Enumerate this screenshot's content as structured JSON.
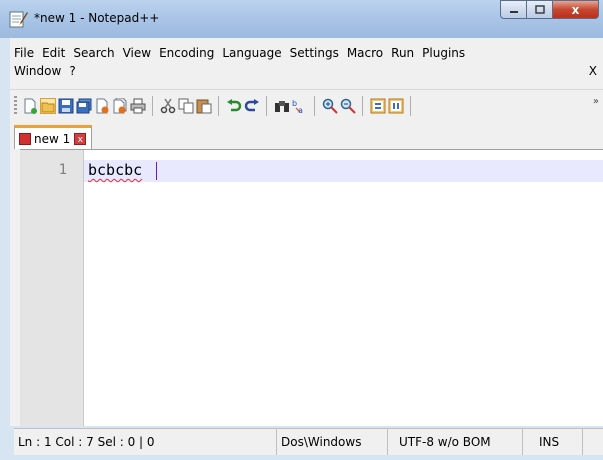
{
  "window": {
    "title": "*new 1 - Notepad++"
  },
  "caption": {
    "minimize": "",
    "maximize": "",
    "close": "x"
  },
  "menu": {
    "row1": [
      "File",
      "Edit",
      "Search",
      "View",
      "Encoding",
      "Language",
      "Settings",
      "Macro",
      "Run",
      "Plugins"
    ],
    "row2": [
      "Window",
      "?"
    ],
    "close_label": "X"
  },
  "toolbar": {
    "icons": [
      "new-file-icon",
      "open-file-icon",
      "save-icon",
      "save-all-icon",
      "close-icon",
      "close-all-icon",
      "print-icon",
      "cut-icon",
      "copy-icon",
      "paste-icon",
      "undo-icon",
      "redo-icon",
      "find-icon",
      "replace-icon",
      "zoom-in-icon",
      "zoom-out-icon",
      "sync-vertical-icon",
      "sync-horizontal-icon"
    ],
    "more": "»"
  },
  "tabs": [
    {
      "label": "new 1",
      "close": "x"
    }
  ],
  "editor": {
    "line_number": "1",
    "text": "bcbcbc"
  },
  "status": {
    "position": "Ln : 1    Col : 7    Sel : 0 | 0",
    "eol": "Dos\\Windows",
    "encoding": "UTF-8 w/o BOM",
    "mode": "INS"
  },
  "colors": {
    "titlebar": "#a9c4e6",
    "close_button": "#c7472f",
    "active_tab_accent": "#f0a030",
    "current_line": "#e8e8ff"
  }
}
